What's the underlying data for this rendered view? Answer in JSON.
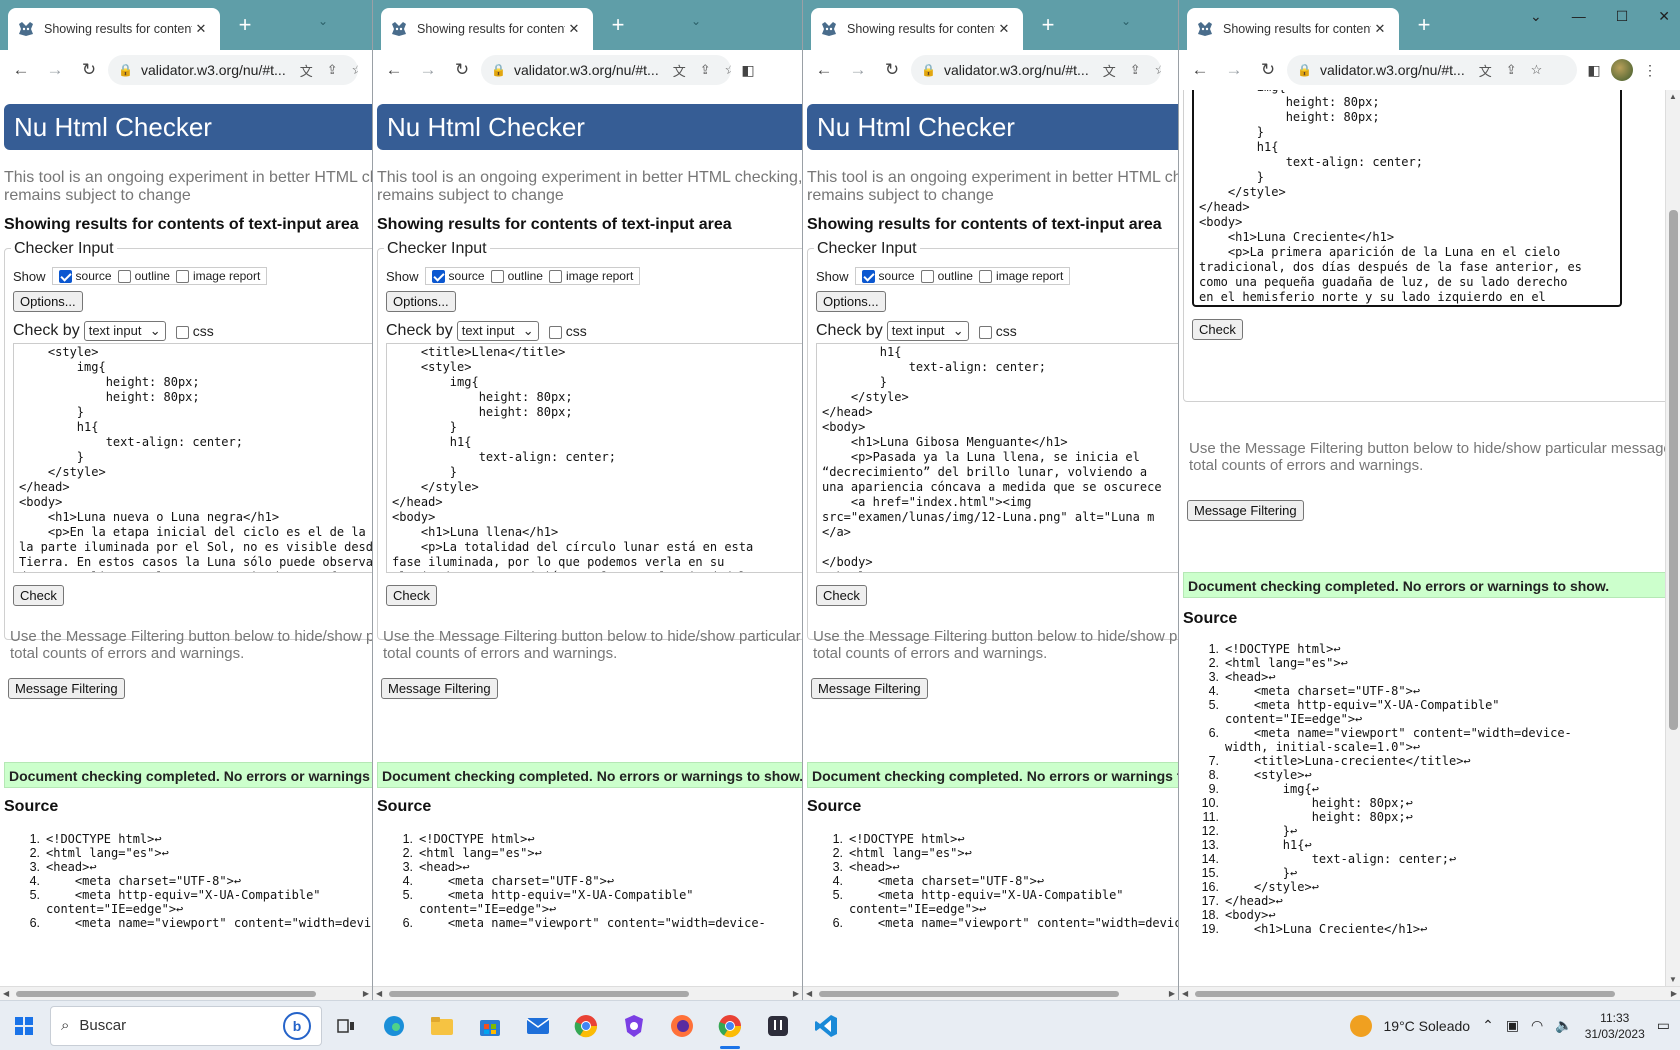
{
  "tab_title": "Showing results for contents o",
  "url": "validator.w3.org/nu/#t...",
  "banner_title": "Nu Html Checker",
  "intro_text": "This tool is an ongoing experiment in better HTML checking, and its behavior remains subject to change",
  "showing_heading": "Showing results for contents of text-input area",
  "checker_input_legend": "Checker Input",
  "show_label": "Show",
  "show_options": {
    "source": "source",
    "outline": "outline",
    "image_report": "image report"
  },
  "options_button": "Options...",
  "check_by_label": "Check by",
  "check_by_value": "text input",
  "css_label": "css",
  "check_button": "Check",
  "filter_info": "Use the Message Filtering button below to hide/show particular messages, and to see total counts of errors and warnings.",
  "filter_button": "Message Filtering",
  "success_message": "Document checking completed. No errors or warnings to show.",
  "source_heading": "Source",
  "windows": [
    {
      "textarea": "    <style>\n        img{\n            height: 80px;\n            height: 80px;\n        }\n        h1{\n            text-align: center;\n        }\n    </style>\n</head>\n<body>\n    <h1>Luna nueva o Luna negra</h1>\n    <p>En la etapa inicial del ciclo es el de la\nla parte iluminada por el Sol, no es visible desde\nTierra. En estos casos la Luna sólo puede observarse\ndurante eclipses solares. A partir de esta fase",
      "source": [
        [
          "1.",
          "<!DOCTYPE html>↩"
        ],
        [
          "2.",
          "<html lang=\"es\">↩"
        ],
        [
          "3.",
          "<head>↩"
        ],
        [
          "4.",
          "    <meta charset=\"UTF-8\">↩"
        ],
        [
          "5.",
          "    <meta http-equiv=\"X-UA-Compatible\""
        ],
        [
          "",
          "content=\"IE=edge\">↩"
        ],
        [
          "6.",
          "    <meta name=\"viewport\" content=\"width=device-"
        ]
      ]
    },
    {
      "textarea": "    <title>Llena</title>\n    <style>\n        img{\n            height: 80px;\n            height: 80px;\n        }\n        h1{\n            text-align: center;\n        }\n    </style>\n</head>\n<body>\n    <h1>Luna llena</h1>\n    <p>La totalidad del círculo lunar está en esta\nfase iluminada, por lo que podemos verla en su\nplenitud. Esta aparición total marca la mitad del mes",
      "source": [
        [
          "1.",
          "<!DOCTYPE html>↩"
        ],
        [
          "2.",
          "<html lang=\"es\">↩"
        ],
        [
          "3.",
          "<head>↩"
        ],
        [
          "4.",
          "    <meta charset=\"UTF-8\">↩"
        ],
        [
          "5.",
          "    <meta http-equiv=\"X-UA-Compatible\""
        ],
        [
          "",
          "content=\"IE=edge\">↩"
        ],
        [
          "6.",
          "    <meta name=\"viewport\" content=\"width=device-"
        ]
      ]
    },
    {
      "textarea": "        h1{\n            text-align: center;\n        }\n    </style>\n</head>\n<body>\n    <h1>Luna Gibosa Menguante</h1>\n    <p>Pasada ya la Luna llena, se inicia el\n“decrecimiento” del brillo lunar, volviendo a\nuna apariencia cóncava a medida que se oscurece\n    <a href=\"index.html\"><img\nsrc=\"examen/lunas/img/12-Luna.png\" alt=\"Luna m\n</a>\n\n</body>\n</html>",
      "source": [
        [
          "1.",
          "<!DOCTYPE html>↩"
        ],
        [
          "2.",
          "<html lang=\"es\">↩"
        ],
        [
          "3.",
          "<head>↩"
        ],
        [
          "4.",
          "    <meta charset=\"UTF-8\">↩"
        ],
        [
          "5.",
          "    <meta http-equiv=\"X-UA-Compatible\""
        ],
        [
          "",
          "content=\"IE=edge\">↩"
        ],
        [
          "6.",
          "    <meta name=\"viewport\" content=\"width=device-"
        ]
      ]
    },
    {
      "textarea": "        img{\n            height: 80px;\n            height: 80px;\n        }\n        h1{\n            text-align: center;\n        }\n    </style>\n</head>\n<body>\n    <h1>Luna Creciente</h1>\n    <p>La primera aparición de la Luna en el cielo\ntradicional, dos días después de la fase anterior, es\ncomo una pequeña guadaña de luz, de su lado derecho\nen el hemisferio norte y su lado izquierdo en el",
      "source": [
        [
          "1.",
          "<!DOCTYPE html>↩"
        ],
        [
          "2.",
          "<html lang=\"es\">↩"
        ],
        [
          "3.",
          "<head>↩"
        ],
        [
          "4.",
          "    <meta charset=\"UTF-8\">↩"
        ],
        [
          "5.",
          "    <meta http-equiv=\"X-UA-Compatible\""
        ],
        [
          "",
          "content=\"IE=edge\">↩"
        ],
        [
          "6.",
          "    <meta name=\"viewport\" content=\"width=device-"
        ],
        [
          "",
          "width, initial-scale=1.0\">↩"
        ],
        [
          "7.",
          "    <title>Luna-creciente</title>↩"
        ],
        [
          "8.",
          "    <style>↩"
        ],
        [
          "9.",
          "        img{↩"
        ],
        [
          "10.",
          "            height: 80px;↩"
        ],
        [
          "11.",
          "            height: 80px;↩"
        ],
        [
          "12.",
          "        }↩"
        ],
        [
          "13.",
          "        h1{↩"
        ],
        [
          "14.",
          "            text-align: center;↩"
        ],
        [
          "15.",
          "        }↩"
        ],
        [
          "16.",
          "    </style>↩"
        ],
        [
          "17.",
          "</head>↩"
        ],
        [
          "18.",
          "<body>↩"
        ],
        [
          "19.",
          "    <h1>Luna Creciente</h1>↩"
        ]
      ]
    }
  ],
  "taskbar": {
    "search_placeholder": "Buscar",
    "weather": "19°C Soleado",
    "time": "11:33",
    "date": "31/03/2023"
  },
  "icons": [
    "nu-logo-icon",
    "close-icon",
    "plus-icon",
    "back-icon",
    "forward-icon",
    "reload-icon",
    "lock-icon",
    "translate-icon",
    "share-icon",
    "star-icon",
    "sidepanel-icon",
    "windows-start-icon",
    "search-icon",
    "bing-icon",
    "task-view-icon",
    "edge-icon",
    "folder-icon",
    "store-icon",
    "mail-icon",
    "chrome-icon",
    "brave-icon",
    "firefox-icon",
    "vscode-icon"
  ]
}
